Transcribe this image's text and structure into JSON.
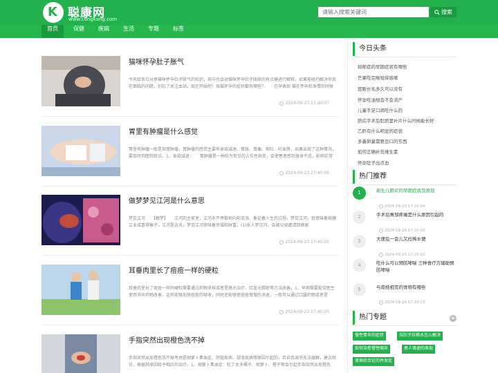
{
  "header": {
    "site_name": "聪康网",
    "site_domain": "www.congkang.com",
    "search_placeholder": "请输入搜索关键词",
    "search_button": "搜索"
  },
  "nav": [
    "首页",
    "保健",
    "疾病",
    "生活",
    "专题",
    "标签"
  ],
  "articles": [
    {
      "title": "猫咪怀孕肚子胀气",
      "summary": "今天给各位分享猫咪怀孕肚子胀气的知识，其中也会对猫咪怀孕肚子胀胀的有点硬进行解释，如果能碰巧解决你现在面临的问题，别忘了关注本站，现在开始吧！母猫怀孕的症状都有哪些？　　已孕表现 猫在怀孕和发情的时候",
      "time": "2024-09-23 17:40:07"
    },
    {
      "title": "胃里有肿瘤是什么感觉",
      "summary": "胃里有肿瘤一般是指胃肿瘤，胃肿瘤的感觉主要有食欲减退、胃胀、胃痛、呕吐、吐血等，如果出现了这种情况，要及时到医院就诊。1、食欲减退：　　胃肿瘤是一种较为常见的占位性病变，会使患者感到身体不适，影响正常",
      "time": "2024-09-23 17:40:06"
    },
    {
      "title": "做梦梦见江河是什么意思",
      "summary": "梦见江河　　【解梦】　　江河的主家室，江河永不停歇地向前流淌，象征着人生的过程。梦见江河，就意味着稳健　　立业成喜得善子，江河是吉兆，梦见江河意味着幸福和财富。(1)女人梦见河，会被父母邀请回娘家",
      "time": "2024-09-23 17:40:05"
    },
    {
      "title": "耳垂肉里长了痘痘一样的硬粒",
      "summary": "耳垂肉里长了痘痘一样的硬粒需要通过药物涂抹或者是激光治疗、红蓝光照射等方法改善。1、早期需要配合医生使用消炎药物改善，这样能够加快痘痘的吸收，同时还能够使痘痘慢慢的消退，一般可以通过口服药物或者是",
      "time": "2024-09-23 17:40:05"
    },
    {
      "title": "手指突然出现橙色洗不掉",
      "summary": "手指突然出现橙色洗不掉考虑是胡萝卜素血症、肝脏疾病、甜液疾病等原因引起的，若自我调节无法缓解，建议就诊，根据其原因给予相应的治疗。1、胡萝卜素血症：吃了太多橘子、胡萝卜、橙子等会引起手指突然出现橙色",
      "time": ""
    }
  ],
  "sidebar": {
    "headlines_title": "今日头条",
    "headlines": [
      "抑郁症的早期症状有哪些",
      "芒果吃完喉咙痒咳嗽",
      "屁眼长毛多久可以没有",
      "怀孕吃油柑会不会流产",
      "儿童手足口病吃什么药",
      "脐疝手术后肚脐里补片什么时候能长好",
      "乙肝有什么明显的症状",
      "多囊卵巢需要忌口的东西",
      "如何正确补充维生素",
      "怀孕肚子出点血"
    ],
    "hot_title": "热门推荐",
    "hot": [
      {
        "rank": "1",
        "title": "新生儿肺炎的早期症状及表现",
        "time": ""
      },
      {
        "rank": "2",
        "title": "手术后胃部疼痛是什么原因引起的",
        "time": "2024-09-23 17:20:04"
      },
      {
        "rank": "3",
        "title": "大便后一会儿又拉稀水便",
        "time": "2024-09-23 17:20:03"
      },
      {
        "rank": "4",
        "title": "吃什么可以预防哮喘 三种食疗方辅助预防哮喘",
        "time": "2024-09-23 17:20:02"
      },
      {
        "rank": "5",
        "title": "与荔枝相克的食物有哪些",
        "time": "2024-09-23 17:10:13"
      }
    ],
    "topics_title": "热门专题",
    "plus": "+",
    "topics": [
      "慢性胃炎的症状",
      "拉肚子拉稀水怎么解决",
      "如何治愈慢性咽炎",
      "男人肾虚的表现",
      "肾病综合征的并发症"
    ]
  },
  "colors": {
    "brand_green": "#22b14c",
    "dark_green": "#1a9b3f"
  }
}
